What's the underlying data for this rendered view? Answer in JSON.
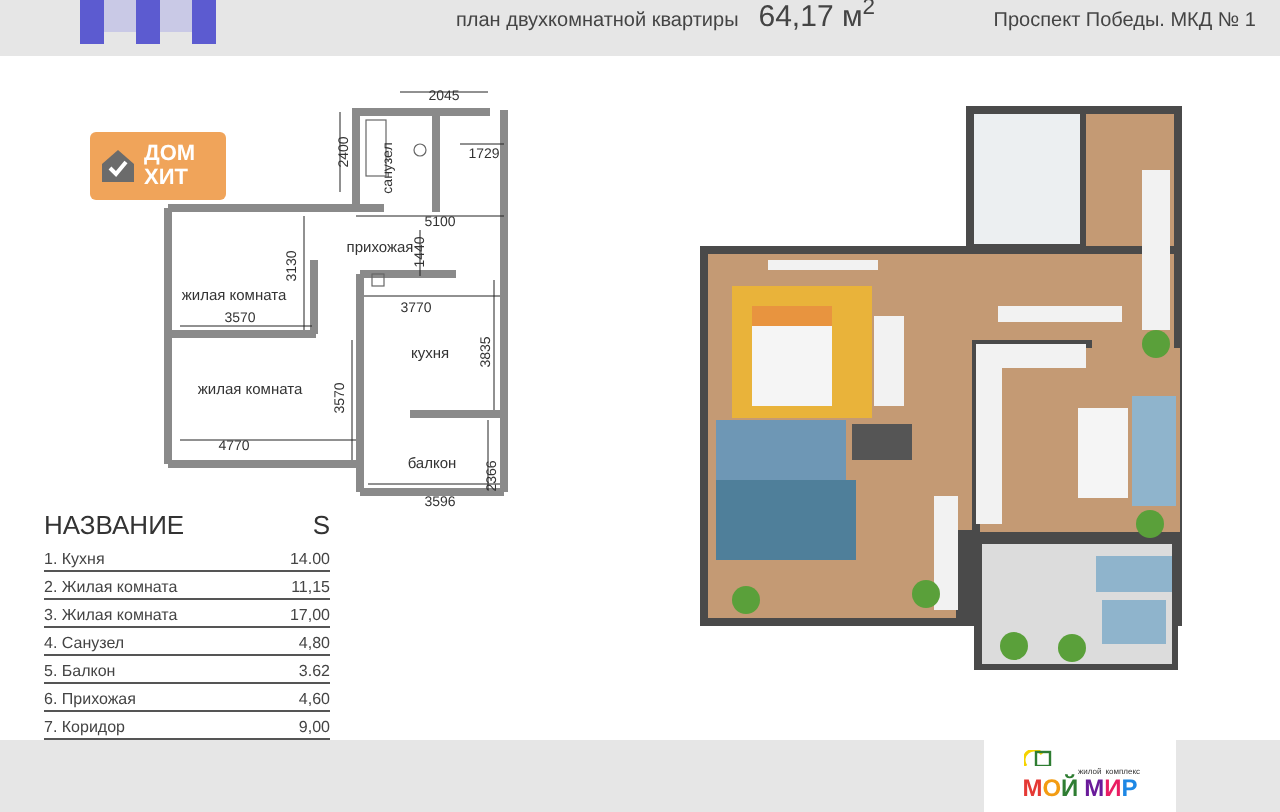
{
  "header": {
    "subtitle": "план двухкомнатной квартиры",
    "area": "64,17 м$^{2}$",
    "address": "Проспект Победы. МКД № 1"
  },
  "badge": {
    "line_1": "ДОМ",
    "line_2": "ХИТ"
  },
  "plan_labels": [
    {
      "text": "2045"
    },
    {
      "text": "2400"
    },
    {
      "text": "1729"
    },
    {
      "text": "санузел"
    },
    {
      "text": "прихожая"
    },
    {
      "text": "5100"
    },
    {
      "text": "1440"
    },
    {
      "text": "3130"
    },
    {
      "text": "жилая комната"
    },
    {
      "text": "3570"
    },
    {
      "text": "3770"
    },
    {
      "text": "кухня"
    },
    {
      "text": "3835"
    },
    {
      "text": "жилая комната"
    },
    {
      "text": "3570"
    },
    {
      "text": "4770"
    },
    {
      "text": "балкон"
    },
    {
      "text": "2366"
    },
    {
      "text": "3596"
    }
  ],
  "table": {
    "columns": [
      "НАЗВАНИЕ",
      "S"
    ],
    "rows": [
      [
        "1. Кухня",
        "14.00"
      ],
      [
        "2. Жилая комната",
        "11,15"
      ],
      [
        "3. Жилая комната",
        "17,00"
      ],
      [
        "4. Санузел",
        "4,80"
      ],
      [
        "5. Балкон",
        "3.62"
      ],
      [
        "6. Прихожая",
        "4,60"
      ],
      [
        "7. Коридор",
        "9,00"
      ]
    ]
  },
  "logo": {
    "tagline_1": "жилой",
    "tagline_2": "комплекс",
    "word_1": "МОЙ",
    "word_2": "МИР"
  }
}
